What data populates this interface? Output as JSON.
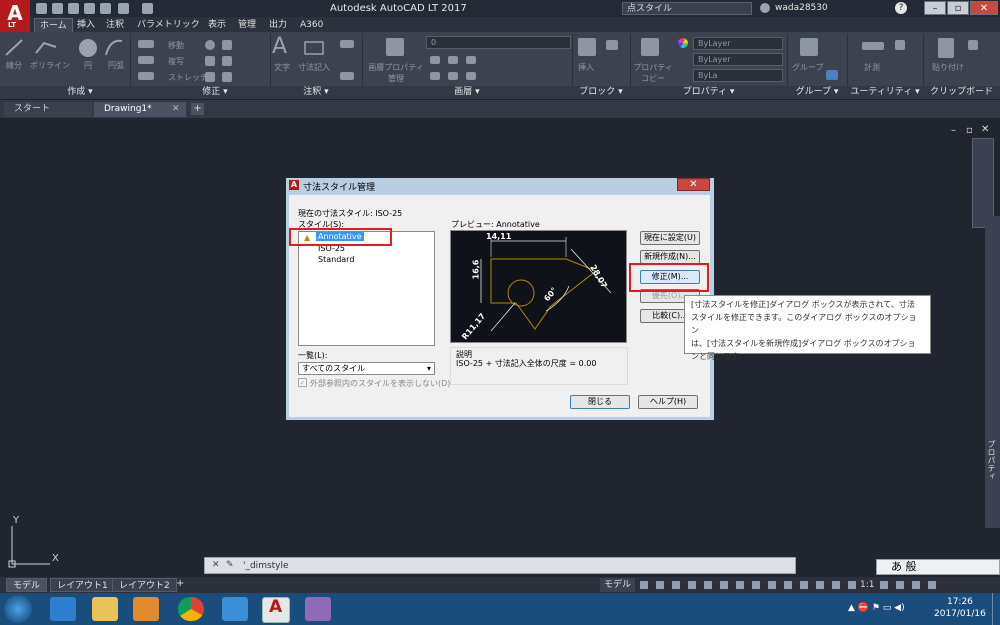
{
  "app": {
    "title": "Autodesk AutoCAD LT 2017",
    "logo_letter": "A",
    "logo_sub": "LT",
    "search_text": "点スタイル",
    "user": "wada28530"
  },
  "menu_tabs": [
    "ホーム",
    "挿入",
    "注釈",
    "パラメトリック",
    "表示",
    "管理",
    "出力",
    "A360"
  ],
  "ribbon": {
    "draw_tools": [
      "線分",
      "ポリライン",
      "円",
      "円弧"
    ],
    "modify_tools": [
      "移動",
      "複写",
      "ストレッチ"
    ],
    "annotation_tools": [
      "文字",
      "寸法記入"
    ],
    "layer_tools": [
      "画層プロパティ管理"
    ],
    "layer_dropdown": "0",
    "block_tools": [
      "挿入"
    ],
    "prop_tools": [
      "プロパティコピー"
    ],
    "bylayer": [
      "ByLayer",
      "ByLayer",
      "ByLa"
    ],
    "group_tools": [
      "グループ"
    ],
    "util_tools": [
      "計測"
    ],
    "clip_tools": [
      "貼り付け"
    ],
    "panel_titles": [
      "作成 ▾",
      "修正 ▾",
      "注釈 ▾",
      "画層 ▾",
      "ブロック ▾",
      "プロパティ ▾",
      "グループ ▾",
      "ユーティリティ ▾",
      "クリップボード"
    ]
  },
  "doc_tabs": [
    "スタート",
    "Drawing1*"
  ],
  "dialog": {
    "title": "寸法スタイル管理",
    "current_style": "現在の寸法スタイル: ISO-25",
    "styles_label": "スタイル(S):",
    "styles": [
      "Annotative",
      "ISO-25",
      "Standard"
    ],
    "preview_label": "プレビュー: Annotative",
    "list_label": "一覧(L):",
    "list_value": "すべてのスタイル",
    "xref_checkbox": "外部参照内のスタイルを表示しない(D)",
    "desc_label": "説明",
    "desc_text": "ISO-25 + 寸法記入全体の尺度 = 0.00",
    "buttons": [
      "現在に設定(U)",
      "新規作成(N)...",
      "修正(M)...",
      "優先(O)...",
      "比較(C)..."
    ],
    "close_button": "閉じる",
    "help_button": "ヘルプ(H)",
    "preview_dims": [
      "14,11",
      "16,6",
      "28,07",
      "60°",
      "R11,17"
    ]
  },
  "tooltip": {
    "line1": "[寸法スタイルを修正]ダイアログ ボックスが表示されて、寸法",
    "line2": "スタイルを修正できます。このダイアログ ボックスのオプション",
    "line3": "は、[寸法スタイルを新規作成]ダイアログ ボックスのオプショ",
    "line4": "ンと同じです。"
  },
  "canvas": {
    "y_label": "Y",
    "x_label": "X",
    "prop_label": "プロパティ"
  },
  "command": {
    "text": "'_dimstyle"
  },
  "ime": {
    "text": "あ 般"
  },
  "layout_tabs": [
    "モデル",
    "レイアウト1",
    "レイアウト2"
  ],
  "status": {
    "model": "モデル",
    "scale": "1:1"
  },
  "taskbar": {
    "time": "17:26",
    "date": "2017/01/16"
  },
  "colors": {
    "accent_red": "#e31b23",
    "canvas_bg": "#21252f",
    "taskbar": "#1b4d7c"
  }
}
